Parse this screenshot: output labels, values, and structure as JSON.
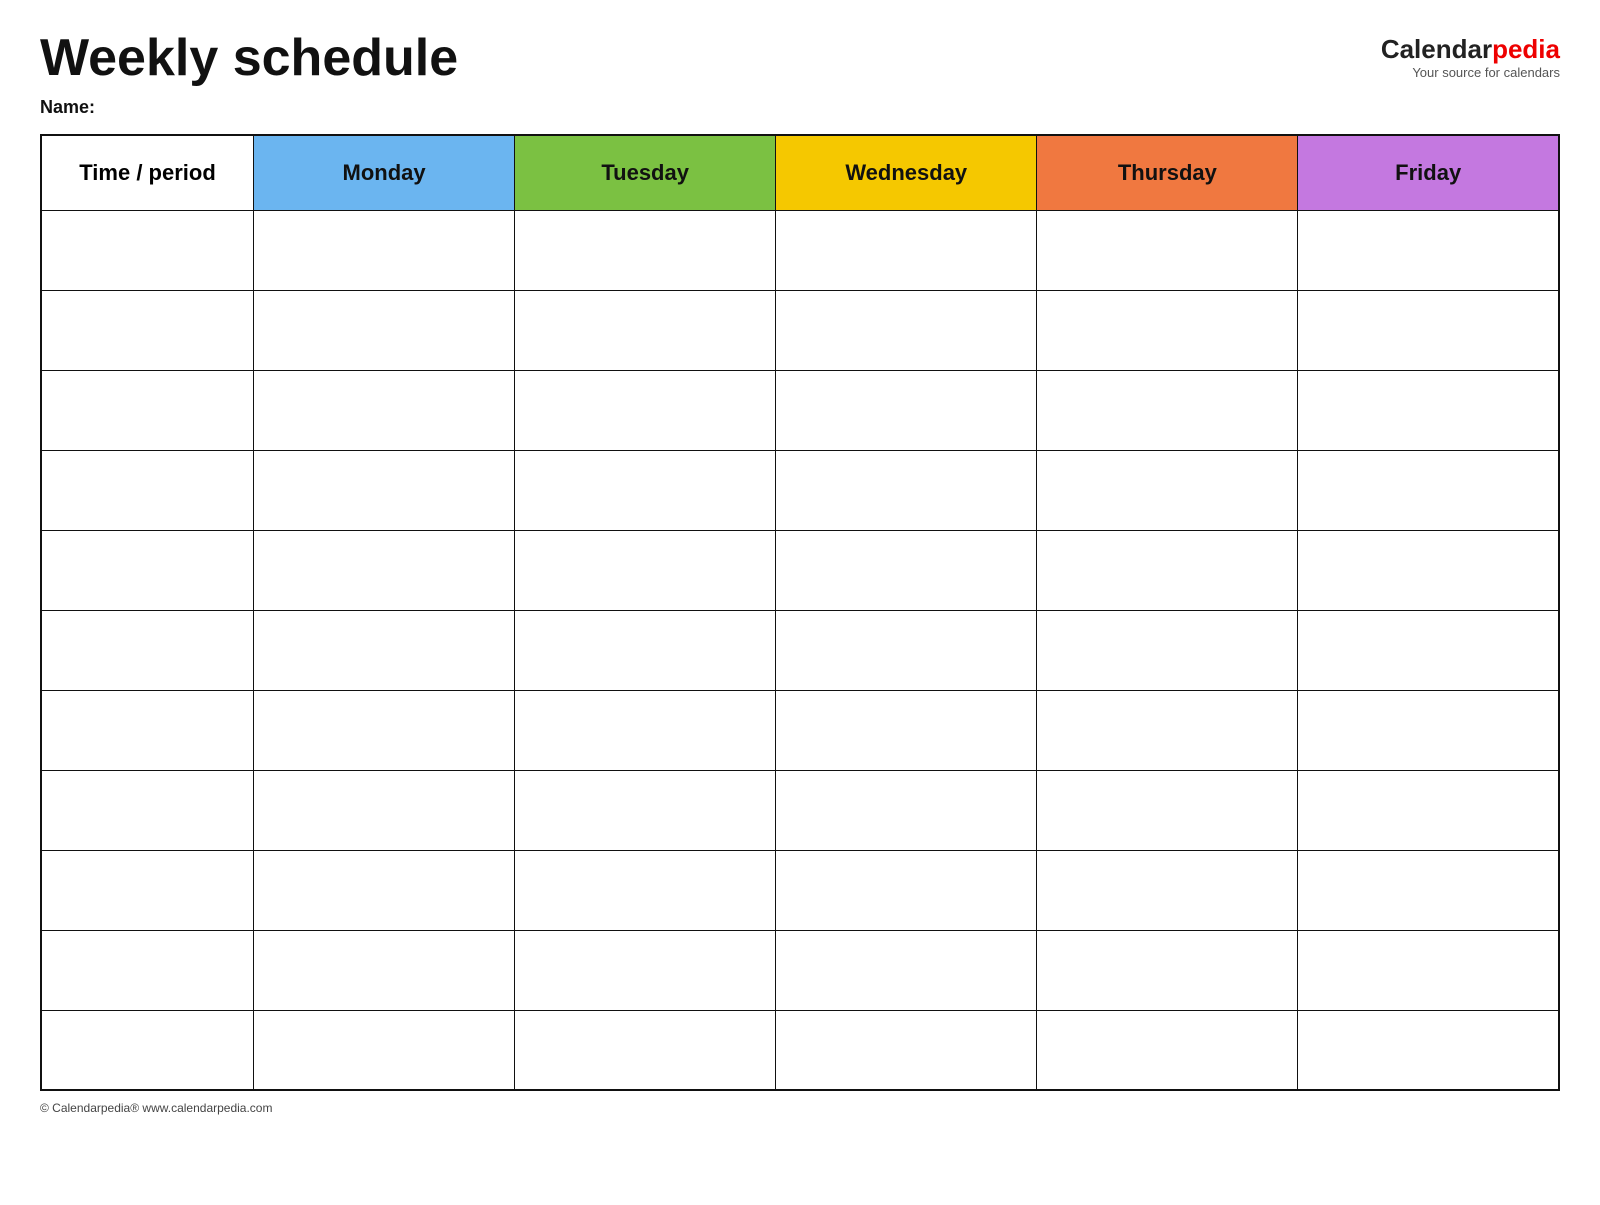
{
  "header": {
    "title": "Weekly schedule",
    "logo_calendar": "Calendar",
    "logo_pedia": "pedia",
    "logo_tagline": "Your source for calendars"
  },
  "name_label": "Name:",
  "table": {
    "columns": [
      {
        "key": "time",
        "label": "Time / period",
        "color": "#fff"
      },
      {
        "key": "monday",
        "label": "Monday",
        "color": "#6bb5f0"
      },
      {
        "key": "tuesday",
        "label": "Tuesday",
        "color": "#7bc142"
      },
      {
        "key": "wednesday",
        "label": "Wednesday",
        "color": "#f5c800"
      },
      {
        "key": "thursday",
        "label": "Thursday",
        "color": "#f07840"
      },
      {
        "key": "friday",
        "label": "Friday",
        "color": "#c478e0"
      }
    ],
    "row_count": 11
  },
  "footer": {
    "copyright": "© Calendarpedia®  www.calendarpedia.com"
  }
}
